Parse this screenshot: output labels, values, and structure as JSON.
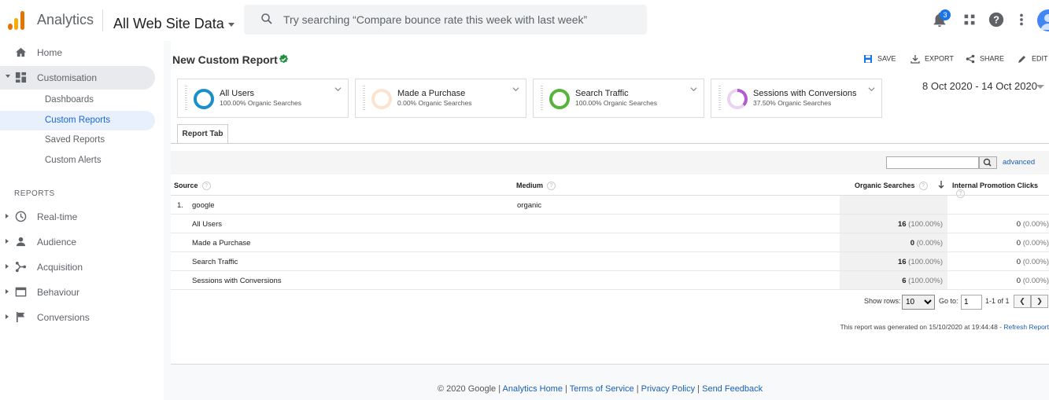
{
  "header": {
    "app_name": "Analytics",
    "property": "All Web Site Data",
    "search_placeholder": "Try searching “Compare bounce rate this week with last week”",
    "notification_count": "3",
    "icons": [
      "notifications-icon",
      "apps-grid-icon",
      "help-icon",
      "more-vert-icon",
      "account-avatar"
    ]
  },
  "sidebar": {
    "top_items": [
      {
        "label": "Home",
        "icon": "home-icon"
      },
      {
        "label": "Customisation",
        "icon": "dashboard-grid-icon",
        "expanded": true
      }
    ],
    "sub_items": [
      {
        "label": "Dashboards"
      },
      {
        "label": "Custom Reports",
        "selected": true
      },
      {
        "label": "Saved Reports"
      },
      {
        "label": "Custom Alerts"
      }
    ],
    "reports_heading": "REPORTS",
    "report_items": [
      {
        "label": "Real-time",
        "icon": "clock-icon"
      },
      {
        "label": "Audience",
        "icon": "person-icon"
      },
      {
        "label": "Acquisition",
        "icon": "acquisition-icon"
      },
      {
        "label": "Behaviour",
        "icon": "behaviour-icon"
      },
      {
        "label": "Conversions",
        "icon": "flag-icon"
      }
    ]
  },
  "report": {
    "title": "New Custom Report",
    "actions": {
      "save": "SAVE",
      "export": "EXPORT",
      "share": "SHARE",
      "edit": "EDIT"
    },
    "date_range": "8 Oct 2020 - 14 Oct 2020",
    "segments": [
      {
        "name": "All Users",
        "sub": "100.00% Organic Searches",
        "color": "#1a8fc9",
        "percent": 100
      },
      {
        "name": "Made a Purchase",
        "sub": "0.00% Organic Searches",
        "color": "#f4c7a1",
        "percent": 0
      },
      {
        "name": "Search Traffic",
        "sub": "100.00% Organic Searches",
        "color": "#55b43a",
        "percent": 100
      },
      {
        "name": "Sessions with Conversions",
        "sub": "37.50% Organic Searches",
        "color": "#b35bd1",
        "percent": 37.5
      }
    ],
    "tab": "Report Tab",
    "advanced": "advanced",
    "columns": {
      "source": "Source",
      "medium": "Medium",
      "organic": "Organic Searches",
      "ipc": "Internal Promotion Clicks"
    },
    "group_row": {
      "num": "1.",
      "source": "google",
      "medium": "organic"
    },
    "rows": [
      {
        "label": "All Users",
        "organic_value": "16",
        "organic_pct": "(100.00%)",
        "ipc_value": "0",
        "ipc_pct": "(0.00%)"
      },
      {
        "label": "Made a Purchase",
        "organic_value": "0",
        "organic_pct": "(0.00%)",
        "ipc_value": "0",
        "ipc_pct": "(0.00%)"
      },
      {
        "label": "Search Traffic",
        "organic_value": "16",
        "organic_pct": "(100.00%)",
        "ipc_value": "0",
        "ipc_pct": "(0.00%)"
      },
      {
        "label": "Sessions with Conversions",
        "organic_value": "6",
        "organic_pct": "(100.00%)",
        "ipc_value": "0",
        "ipc_pct": "(0.00%)"
      }
    ],
    "pager": {
      "show_rows_label": "Show rows:",
      "show_rows_value": "10",
      "goto_label": "Go to:",
      "goto_value": "1",
      "range": "1-1 of 1",
      "prev": "❮",
      "next": "❯"
    },
    "generated_text": "This report was generated on 15/10/2020 at 19:44:48 - ",
    "refresh_link": "Refresh Report"
  },
  "footer": {
    "copyright": "© 2020 Google",
    "sep": " | ",
    "links": [
      "Analytics Home",
      "Terms of Service",
      "Privacy Policy",
      "Send Feedback"
    ]
  }
}
